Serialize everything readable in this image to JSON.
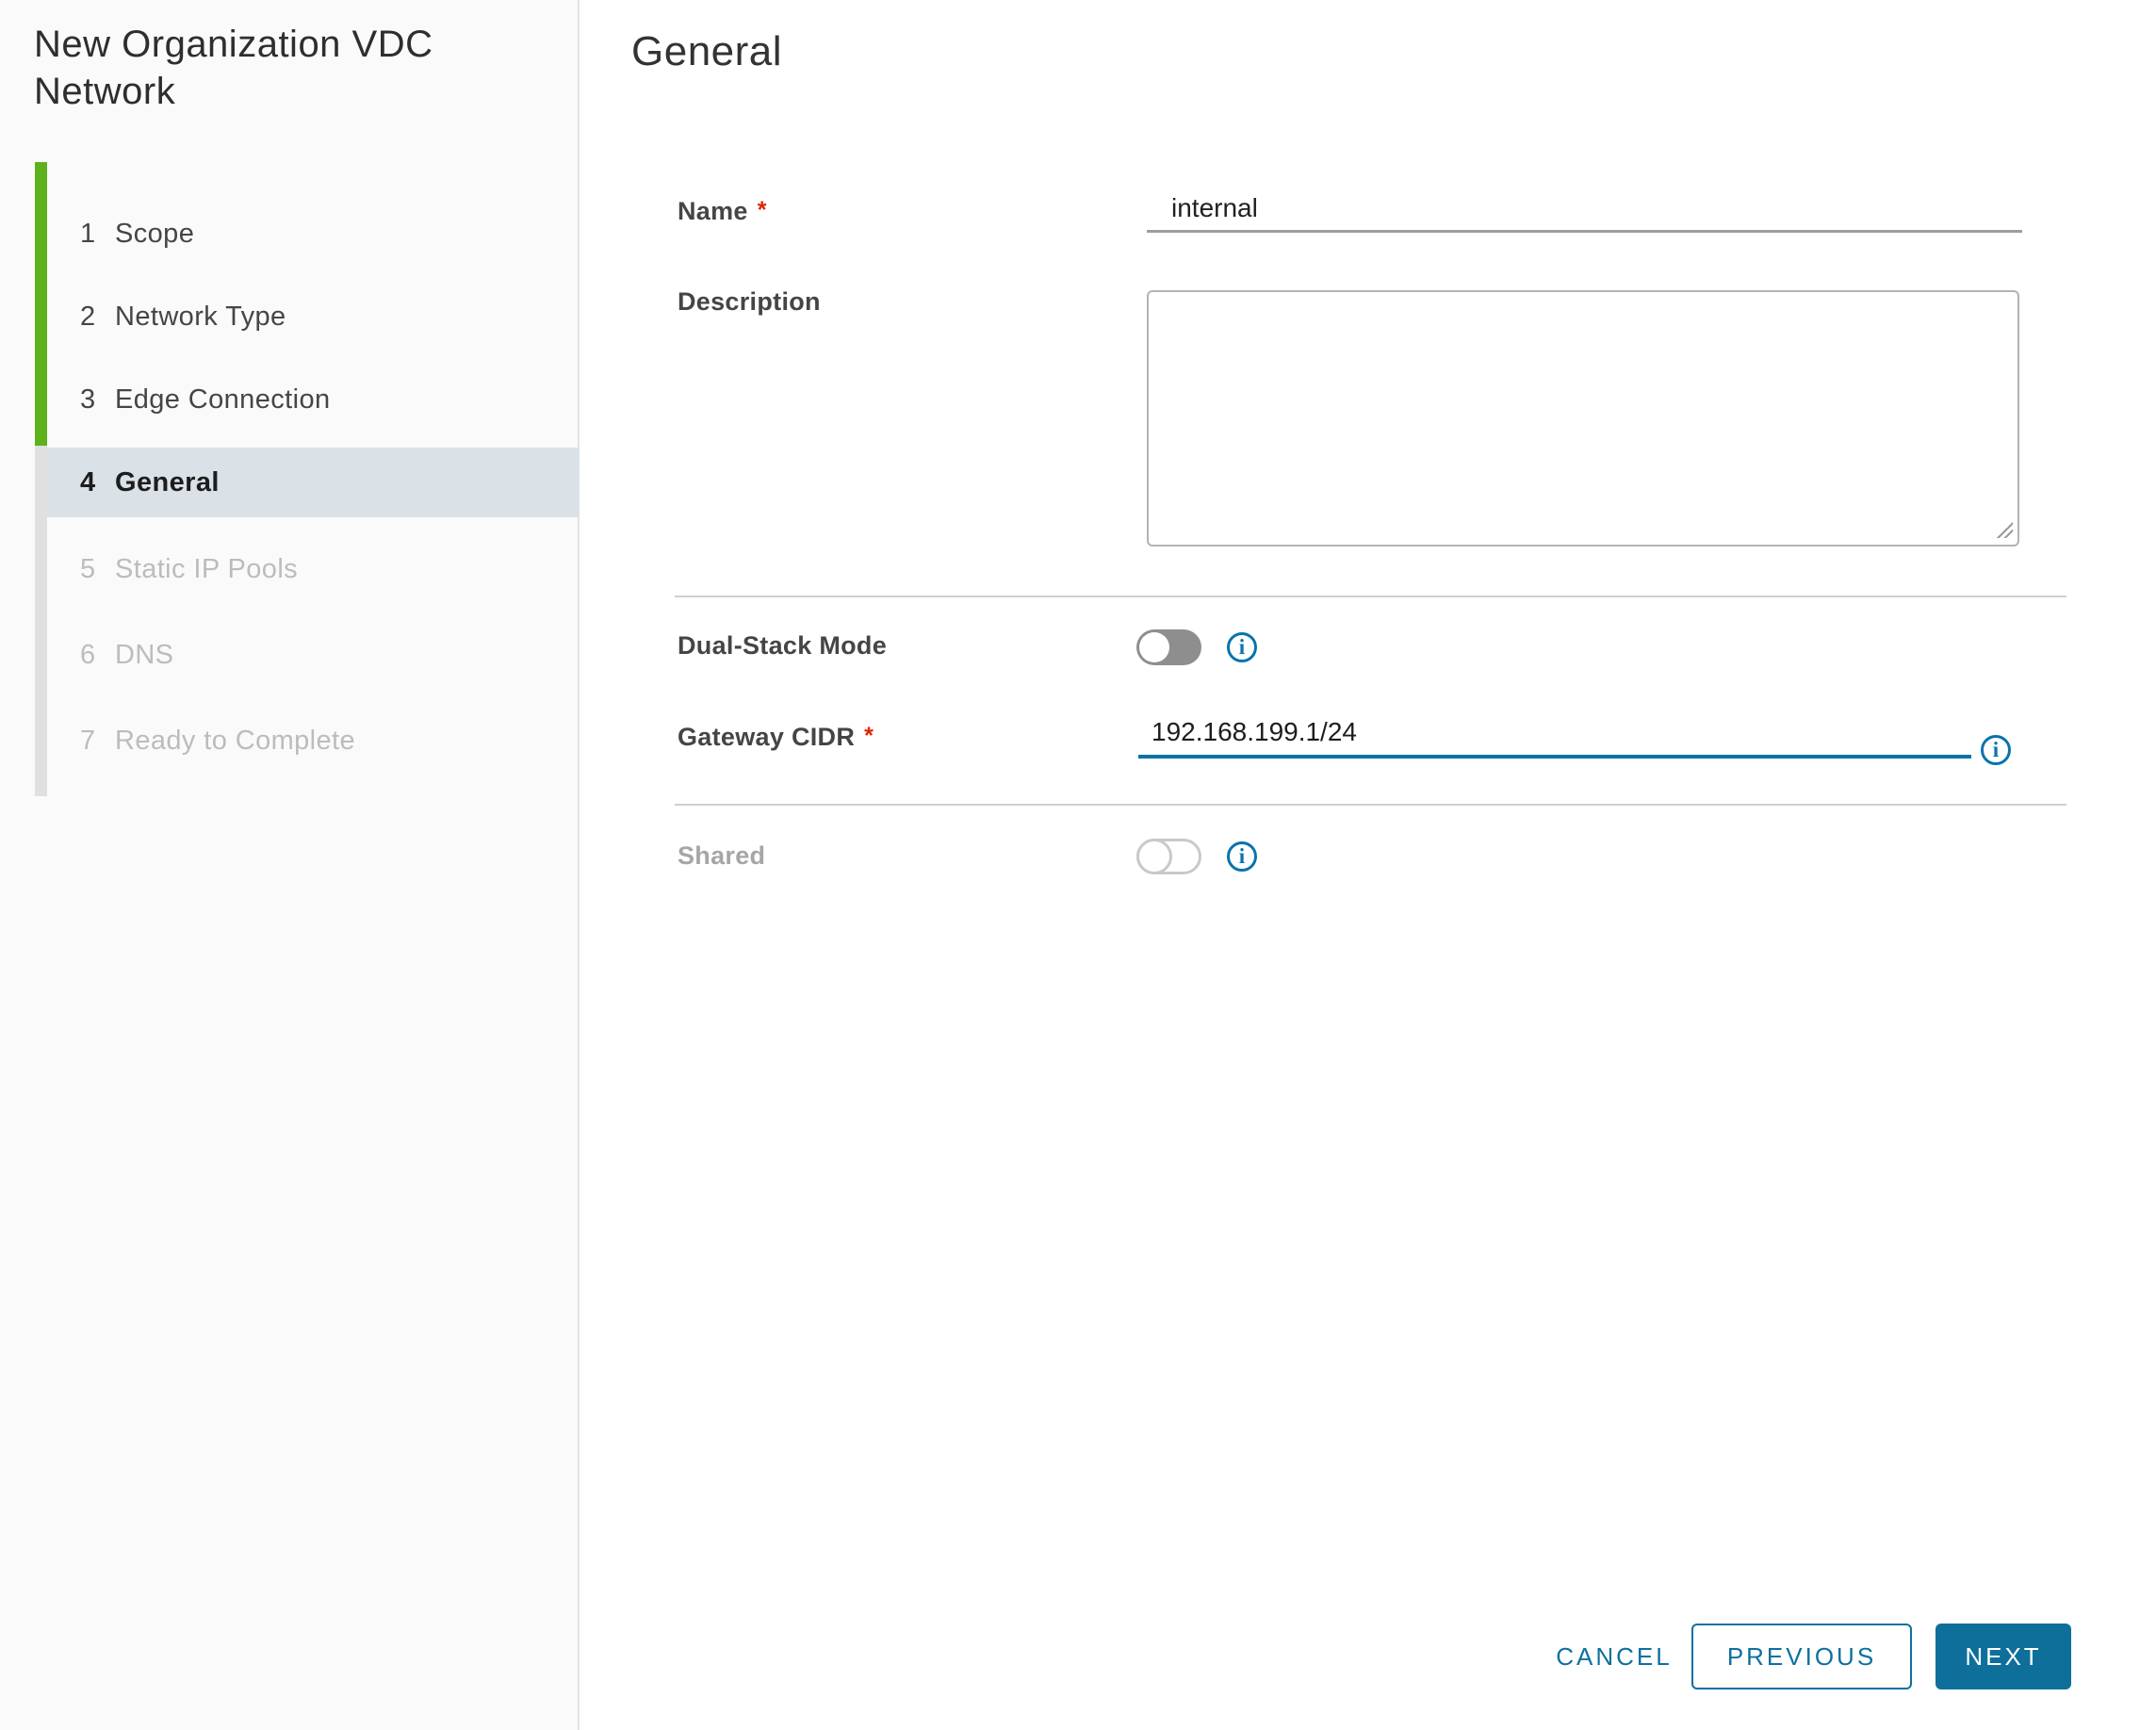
{
  "wizard": {
    "title": "New Organization VDC Network",
    "active_step": "4",
    "steps": [
      {
        "num": "1",
        "label": "Scope"
      },
      {
        "num": "2",
        "label": "Network Type"
      },
      {
        "num": "3",
        "label": "Edge Connection"
      },
      {
        "num": "4",
        "label": "General"
      },
      {
        "num": "5",
        "label": "Static IP Pools"
      },
      {
        "num": "6",
        "label": "DNS"
      },
      {
        "num": "7",
        "label": "Ready to Complete"
      }
    ]
  },
  "content": {
    "heading": "General",
    "required_marker": "*",
    "info_icon_glyph": "i",
    "name": {
      "label": "Name",
      "value": "internal"
    },
    "description": {
      "label": "Description",
      "value": ""
    },
    "dual_stack": {
      "label": "Dual-Stack Mode",
      "state": "off"
    },
    "gateway_cidr": {
      "label": "Gateway CIDR",
      "value": "192.168.199.1/24"
    },
    "shared": {
      "label": "Shared",
      "state": "off",
      "disabled": true
    }
  },
  "footer": {
    "cancel_label": "CANCEL",
    "previous_label": "PREVIOUS",
    "next_label": "NEXT"
  },
  "colors": {
    "accent_blue": "#0e709e",
    "icon_blue": "#0a73ad",
    "focus_underline_blue": "#0673a5",
    "progress_green": "#5db21c",
    "active_step_bg": "#dae2e8",
    "required_red": "#e12200",
    "sidebar_bg": "#fafafa"
  }
}
